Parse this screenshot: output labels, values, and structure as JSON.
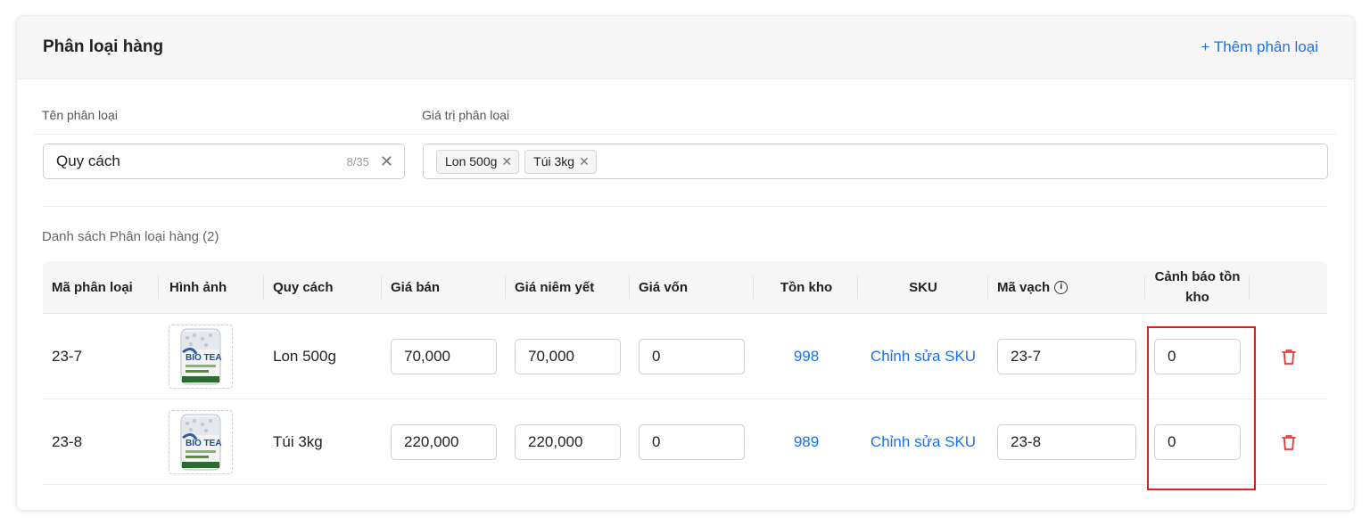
{
  "header": {
    "title": "Phân loại hàng",
    "add_label": "+ Thêm phân loại"
  },
  "variant_form": {
    "name_label": "Tên phân loại",
    "value_label": "Giá trị phân loại",
    "name_value": "Quy cách",
    "name_counter": "8/35",
    "tags": [
      "Lon 500g",
      "Túi 3kg"
    ]
  },
  "list": {
    "title": "Danh sách Phân loại hàng (2)",
    "columns": {
      "code": "Mã phân loại",
      "image": "Hình ảnh",
      "spec": "Quy cách",
      "price": "Giá bán",
      "list_price": "Giá niêm yết",
      "cost": "Giá vốn",
      "stock": "Tồn kho",
      "sku": "SKU",
      "barcode": "Mã vạch",
      "stock_alert": "Cảnh báo tồn kho"
    },
    "rows": [
      {
        "code": "23-7",
        "spec": "Lon 500g",
        "price": "70,000",
        "list_price": "70,000",
        "cost": "0",
        "stock": "998",
        "sku_link": "Chỉnh sửa SKU",
        "barcode": "23-7",
        "stock_alert": "0"
      },
      {
        "code": "23-8",
        "spec": "Túi 3kg",
        "price": "220,000",
        "list_price": "220,000",
        "cost": "0",
        "stock": "989",
        "sku_link": "Chỉnh sửa SKU",
        "barcode": "23-8",
        "stock_alert": "0"
      }
    ]
  },
  "icons": {
    "clear": "close-icon",
    "tag_remove": "close-icon",
    "info": "info-icon",
    "delete": "trash-icon",
    "thumbnail": "product-can-image"
  },
  "colors": {
    "accent": "#1a73e8",
    "danger": "#e53935",
    "highlight": "#e02020"
  }
}
